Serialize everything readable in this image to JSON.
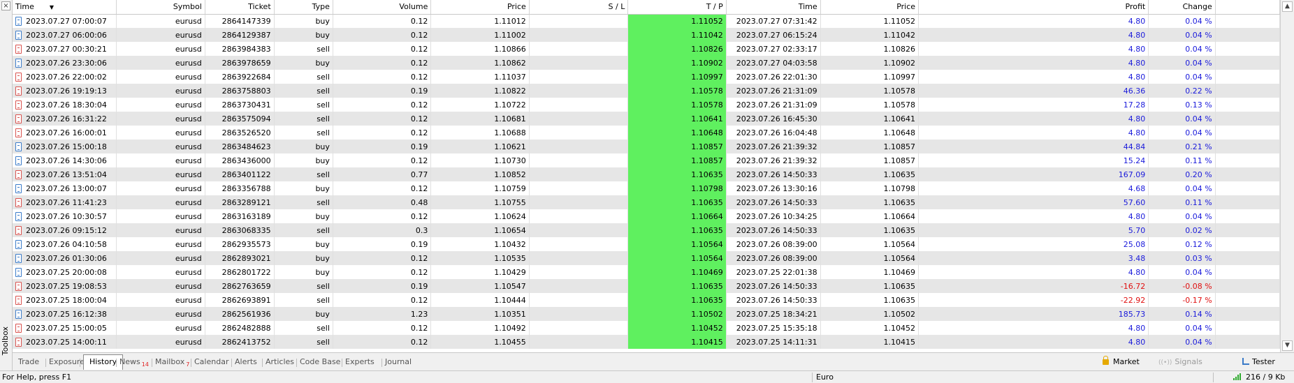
{
  "toolbox": {
    "label": "Toolbox",
    "close": "×"
  },
  "columns": [
    "Time",
    "Symbol",
    "Ticket",
    "Type",
    "Volume",
    "Price",
    "S / L",
    "T / P",
    "Time",
    "Price",
    "Profit",
    "Change"
  ],
  "sort_indicator": "▼",
  "rows": [
    [
      "2023.07.27 07:00:07",
      "eurusd",
      "2864147339",
      "buy",
      "0.12",
      "1.11012",
      "",
      "1.11052",
      "2023.07.27 07:31:42",
      "1.11052",
      "4.80",
      "0.04 %"
    ],
    [
      "2023.07.27 06:00:06",
      "eurusd",
      "2864129387",
      "buy",
      "0.12",
      "1.11002",
      "",
      "1.11042",
      "2023.07.27 06:15:24",
      "1.11042",
      "4.80",
      "0.04 %"
    ],
    [
      "2023.07.27 00:30:21",
      "eurusd",
      "2863984383",
      "sell",
      "0.12",
      "1.10866",
      "",
      "1.10826",
      "2023.07.27 02:33:17",
      "1.10826",
      "4.80",
      "0.04 %"
    ],
    [
      "2023.07.26 23:30:06",
      "eurusd",
      "2863978659",
      "buy",
      "0.12",
      "1.10862",
      "",
      "1.10902",
      "2023.07.27 04:03:58",
      "1.10902",
      "4.80",
      "0.04 %"
    ],
    [
      "2023.07.26 22:00:02",
      "eurusd",
      "2863922684",
      "sell",
      "0.12",
      "1.11037",
      "",
      "1.10997",
      "2023.07.26 22:01:30",
      "1.10997",
      "4.80",
      "0.04 %"
    ],
    [
      "2023.07.26 19:19:13",
      "eurusd",
      "2863758803",
      "sell",
      "0.19",
      "1.10822",
      "",
      "1.10578",
      "2023.07.26 21:31:09",
      "1.10578",
      "46.36",
      "0.22 %"
    ],
    [
      "2023.07.26 18:30:04",
      "eurusd",
      "2863730431",
      "sell",
      "0.12",
      "1.10722",
      "",
      "1.10578",
      "2023.07.26 21:31:09",
      "1.10578",
      "17.28",
      "0.13 %"
    ],
    [
      "2023.07.26 16:31:22",
      "eurusd",
      "2863575094",
      "sell",
      "0.12",
      "1.10681",
      "",
      "1.10641",
      "2023.07.26 16:45:30",
      "1.10641",
      "4.80",
      "0.04 %"
    ],
    [
      "2023.07.26 16:00:01",
      "eurusd",
      "2863526520",
      "sell",
      "0.12",
      "1.10688",
      "",
      "1.10648",
      "2023.07.26 16:04:48",
      "1.10648",
      "4.80",
      "0.04 %"
    ],
    [
      "2023.07.26 15:00:18",
      "eurusd",
      "2863484623",
      "buy",
      "0.19",
      "1.10621",
      "",
      "1.10857",
      "2023.07.26 21:39:32",
      "1.10857",
      "44.84",
      "0.21 %"
    ],
    [
      "2023.07.26 14:30:06",
      "eurusd",
      "2863436000",
      "buy",
      "0.12",
      "1.10730",
      "",
      "1.10857",
      "2023.07.26 21:39:32",
      "1.10857",
      "15.24",
      "0.11 %"
    ],
    [
      "2023.07.26 13:51:04",
      "eurusd",
      "2863401122",
      "sell",
      "0.77",
      "1.10852",
      "",
      "1.10635",
      "2023.07.26 14:50:33",
      "1.10635",
      "167.09",
      "0.20 %"
    ],
    [
      "2023.07.26 13:00:07",
      "eurusd",
      "2863356788",
      "buy",
      "0.12",
      "1.10759",
      "",
      "1.10798",
      "2023.07.26 13:30:16",
      "1.10798",
      "4.68",
      "0.04 %"
    ],
    [
      "2023.07.26 11:41:23",
      "eurusd",
      "2863289121",
      "sell",
      "0.48",
      "1.10755",
      "",
      "1.10635",
      "2023.07.26 14:50:33",
      "1.10635",
      "57.60",
      "0.11 %"
    ],
    [
      "2023.07.26 10:30:57",
      "eurusd",
      "2863163189",
      "buy",
      "0.12",
      "1.10624",
      "",
      "1.10664",
      "2023.07.26 10:34:25",
      "1.10664",
      "4.80",
      "0.04 %"
    ],
    [
      "2023.07.26 09:15:12",
      "eurusd",
      "2863068335",
      "sell",
      "0.3",
      "1.10654",
      "",
      "1.10635",
      "2023.07.26 14:50:33",
      "1.10635",
      "5.70",
      "0.02 %"
    ],
    [
      "2023.07.26 04:10:58",
      "eurusd",
      "2862935573",
      "buy",
      "0.19",
      "1.10432",
      "",
      "1.10564",
      "2023.07.26 08:39:00",
      "1.10564",
      "25.08",
      "0.12 %"
    ],
    [
      "2023.07.26 01:30:06",
      "eurusd",
      "2862893021",
      "buy",
      "0.12",
      "1.10535",
      "",
      "1.10564",
      "2023.07.26 08:39:00",
      "1.10564",
      "3.48",
      "0.03 %"
    ],
    [
      "2023.07.25 20:00:08",
      "eurusd",
      "2862801722",
      "buy",
      "0.12",
      "1.10429",
      "",
      "1.10469",
      "2023.07.25 22:01:38",
      "1.10469",
      "4.80",
      "0.04 %"
    ],
    [
      "2023.07.25 19:08:53",
      "eurusd",
      "2862763659",
      "sell",
      "0.19",
      "1.10547",
      "",
      "1.10635",
      "2023.07.26 14:50:33",
      "1.10635",
      "-16.72",
      "-0.08 %"
    ],
    [
      "2023.07.25 18:00:04",
      "eurusd",
      "2862693891",
      "sell",
      "0.12",
      "1.10444",
      "",
      "1.10635",
      "2023.07.26 14:50:33",
      "1.10635",
      "-22.92",
      "-0.17 %"
    ],
    [
      "2023.07.25 16:12:38",
      "eurusd",
      "2862561936",
      "buy",
      "1.23",
      "1.10351",
      "",
      "1.10502",
      "2023.07.25 18:34:21",
      "1.10502",
      "185.73",
      "0.14 %"
    ],
    [
      "2023.07.25 15:00:05",
      "eurusd",
      "2862482888",
      "sell",
      "0.12",
      "1.10492",
      "",
      "1.10452",
      "2023.07.25 15:35:18",
      "1.10452",
      "4.80",
      "0.04 %"
    ],
    [
      "2023.07.25 14:00:11",
      "eurusd",
      "2862413752",
      "sell",
      "0.12",
      "1.10455",
      "",
      "1.10415",
      "2023.07.25 14:11:31",
      "1.10415",
      "4.80",
      "0.04 %"
    ]
  ],
  "tabs": [
    {
      "label": "Trade",
      "badge": ""
    },
    {
      "label": "Exposure",
      "badge": ""
    },
    {
      "label": "History",
      "badge": ""
    },
    {
      "label": "News",
      "badge": "14"
    },
    {
      "label": "Mailbox",
      "badge": "7"
    },
    {
      "label": "Calendar",
      "badge": ""
    },
    {
      "label": "Alerts",
      "badge": ""
    },
    {
      "label": "Articles",
      "badge": ""
    },
    {
      "label": "Code Base",
      "badge": ""
    },
    {
      "label": "Experts",
      "badge": ""
    },
    {
      "label": "Journal",
      "badge": ""
    }
  ],
  "active_tab": "History",
  "right_buttons": {
    "market": "Market",
    "signals": "Signals",
    "tester": "Tester"
  },
  "status": {
    "help": "For Help, press F1",
    "profile": "Euro",
    "traffic": "216 / 9 Kb"
  },
  "colors": {
    "tp_highlight": "#5ff05f",
    "profit_positive": "#1a1adb",
    "profit_negative": "#e01010"
  },
  "icons": {
    "close": "close-icon",
    "buy_row": "deal-buy-icon",
    "sell_row": "deal-sell-icon",
    "market": "lock-icon",
    "signals": "signal-wave-icon",
    "tester": "tester-icon",
    "traffic": "connection-bars-icon"
  }
}
